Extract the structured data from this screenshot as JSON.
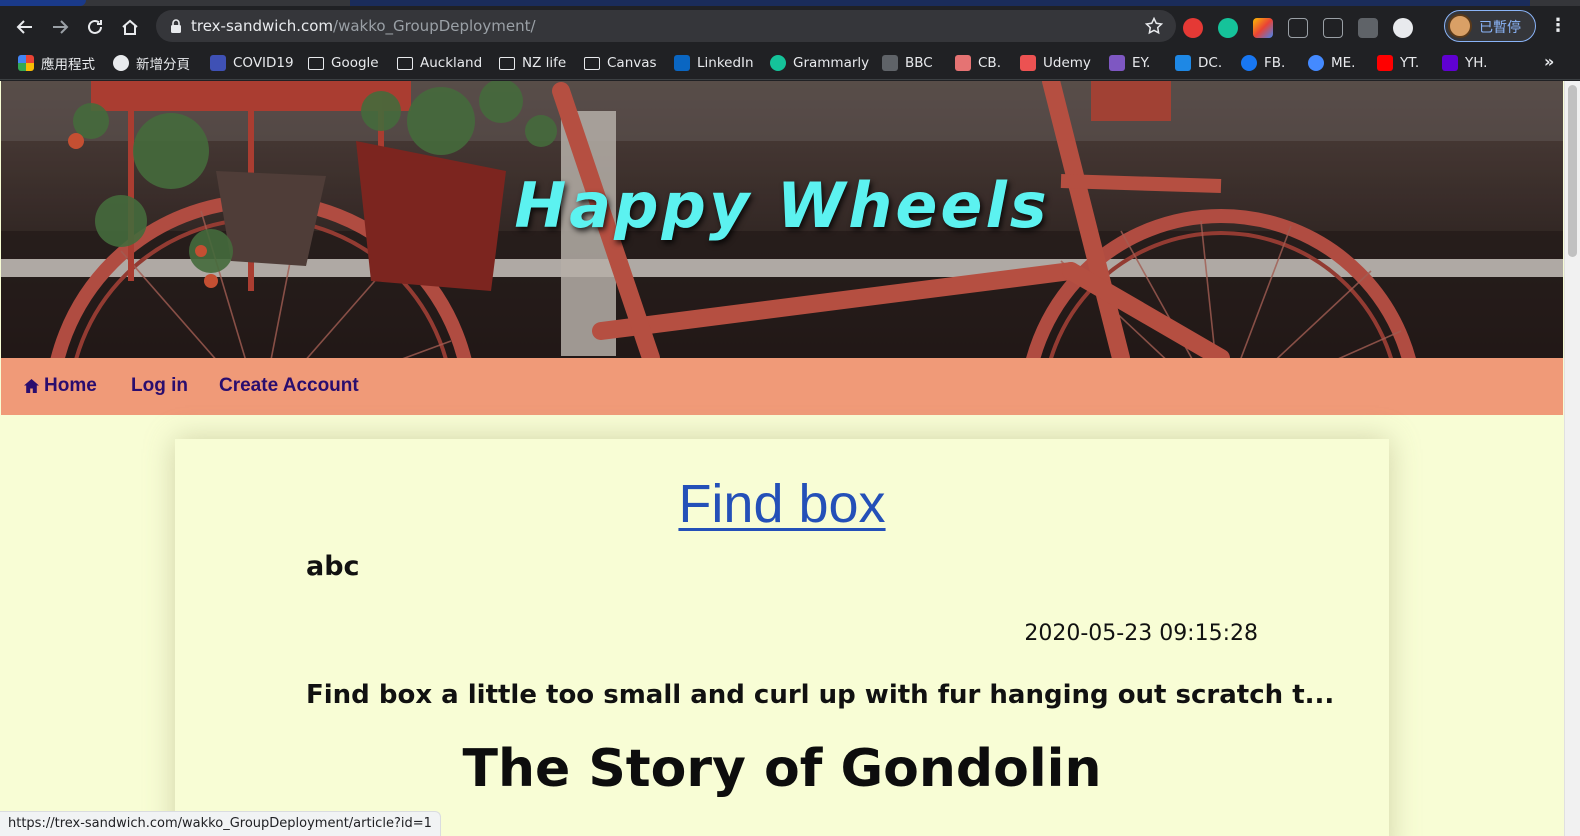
{
  "browser": {
    "url_host": "trex-sandwich.com",
    "url_path": "/wakko_GroupDeployment/",
    "profile_label": "已暫停",
    "status_url": "https://trex-sandwich.com/wakko_GroupDeployment/article?id=1",
    "bookmarks": [
      {
        "label": "應用程式",
        "icon": "apps-grid-icon"
      },
      {
        "label": "新增分頁",
        "icon": "globe-icon"
      },
      {
        "label": "COVID19",
        "icon": "covid-icon"
      },
      {
        "label": "Google",
        "icon": "folder-icon"
      },
      {
        "label": "Auckland",
        "icon": "folder-icon"
      },
      {
        "label": "NZ life",
        "icon": "folder-icon"
      },
      {
        "label": "Canvas",
        "icon": "folder-icon"
      },
      {
        "label": "LinkedIn",
        "icon": "linkedin-icon"
      },
      {
        "label": "Grammarly",
        "icon": "grammarly-icon"
      },
      {
        "label": "BBC",
        "icon": "bbc-icon"
      },
      {
        "label": "CB.",
        "icon": "cb-icon"
      },
      {
        "label": "Udemy",
        "icon": "udemy-icon"
      },
      {
        "label": "EY.",
        "icon": "ey-icon"
      },
      {
        "label": "DC.",
        "icon": "dc-icon"
      },
      {
        "label": "FB.",
        "icon": "facebook-icon"
      },
      {
        "label": "ME.",
        "icon": "messenger-icon"
      },
      {
        "label": "YT.",
        "icon": "youtube-icon"
      },
      {
        "label": "YH.",
        "icon": "yahoo-icon"
      }
    ]
  },
  "site": {
    "title": "Happy Wheels",
    "nav": {
      "home": "Home",
      "login": "Log in",
      "create_account": "Create Account"
    }
  },
  "article": {
    "title": "Find box",
    "subtitle": "abc",
    "timestamp": "2020-05-23 09:15:28",
    "excerpt": "Find box a little too small and curl up with fur hanging out scratch t..."
  },
  "next_article": {
    "title": "The Story of Gondolin"
  },
  "colors": {
    "page_bg": "#f8fdd5",
    "navbar_bg": "#f09a78",
    "nav_text": "#2a0d6e",
    "title_cyan": "#5cf2f0",
    "link_blue": "#2450b8"
  }
}
